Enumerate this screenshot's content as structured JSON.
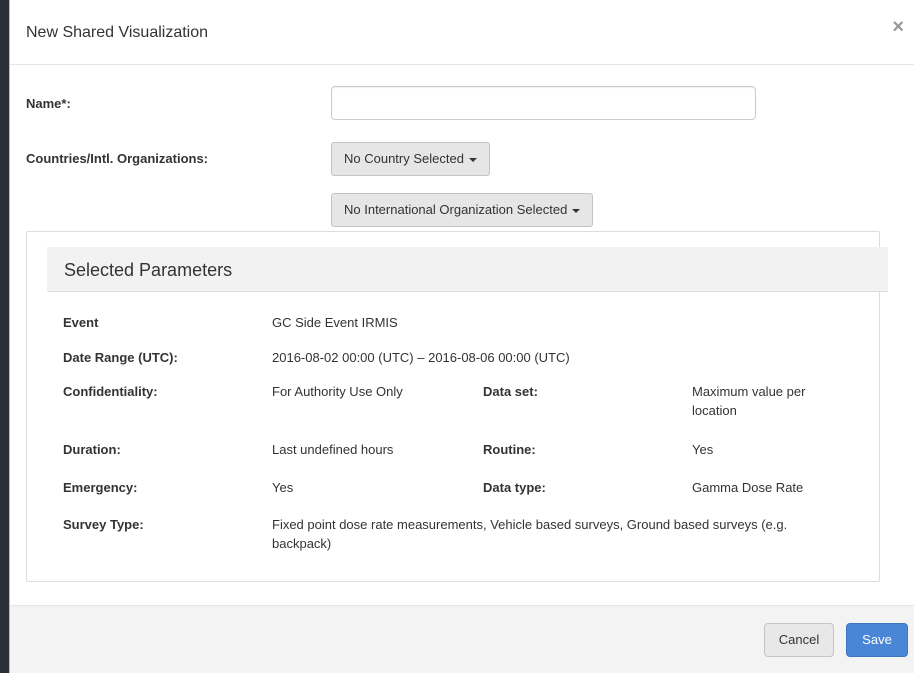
{
  "dialog": {
    "title": "New Shared Visualization",
    "close_glyph": "×"
  },
  "form": {
    "name_label": "Name*:",
    "name_value": "",
    "countries_label": "Countries/Intl. Organizations:",
    "country_dropdown": "No Country Selected",
    "org_dropdown": "No International Organization Selected"
  },
  "parameters": {
    "title": "Selected Parameters",
    "event_label": "Event",
    "event_value": "GC Side Event IRMIS",
    "date_label": "Date Range (UTC):",
    "date_value": "2016-08-02 00:00 (UTC) – 2016-08-06 00:00 (UTC)",
    "confidentiality_label": "Confidentiality:",
    "confidentiality_value": "For Authority Use Only",
    "dataset_label": "Data set:",
    "dataset_value": "Maximum value per location",
    "duration_label": "Duration:",
    "duration_value": "Last undefined hours",
    "routine_label": "Routine:",
    "routine_value": "Yes",
    "emergency_label": "Emergency:",
    "emergency_value": "Yes",
    "datatype_label": "Data type:",
    "datatype_value": "Gamma Dose Rate",
    "survey_label": "Survey Type:",
    "survey_value": "Fixed point dose rate measurements, Vehicle based surveys, Ground based surveys (e.g. backpack)"
  },
  "footer": {
    "cancel_label": "Cancel",
    "save_label": "Save"
  },
  "colors": {
    "primary": "#4a86d6",
    "panel_header": "#f2f2f2"
  }
}
